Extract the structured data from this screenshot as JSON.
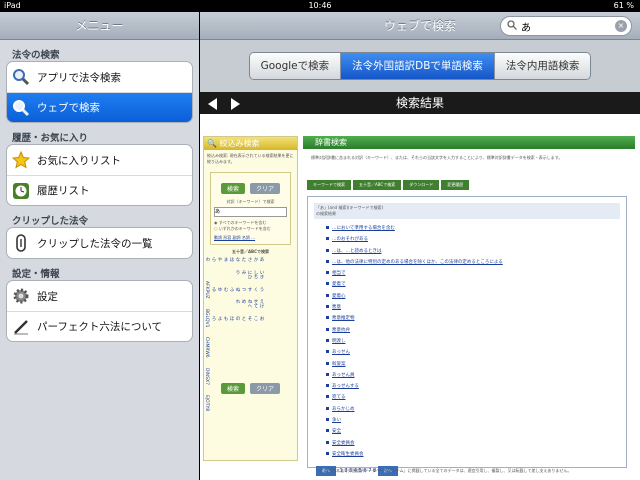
{
  "status": {
    "device": "iPad",
    "time": "10:46",
    "battery": "61 %"
  },
  "sidebar": {
    "title": "メニュー",
    "sections": [
      {
        "header": "法令の検索",
        "items": [
          {
            "label": "アプリで法令検索",
            "icon": "magnifier-icon"
          },
          {
            "label": "ウェブで検索",
            "icon": "magnifier-icon",
            "selected": true
          }
        ]
      },
      {
        "header": "履歴・お気に入り",
        "items": [
          {
            "label": "お気に入りリスト",
            "icon": "star-icon"
          },
          {
            "label": "履歴リスト",
            "icon": "clock-icon"
          }
        ]
      },
      {
        "header": "クリップした法令",
        "items": [
          {
            "label": "クリップした法令の一覧",
            "icon": "paperclip-icon"
          }
        ]
      },
      {
        "header": "設定・情報",
        "items": [
          {
            "label": "設定",
            "icon": "gear-icon"
          },
          {
            "label": "パーフェクト六法について",
            "icon": "pen-icon"
          }
        ]
      }
    ]
  },
  "main": {
    "title": "ウェブで検索",
    "search_value": "あ",
    "segments": [
      "Googleで検索",
      "法令外国語訳DBで単語検索",
      "法令内用語検索"
    ],
    "selected_segment": 1,
    "result_title": "検索結果"
  },
  "page": {
    "left_title": "絞込み検索",
    "left_desc": "絞込み検索: 現在表示されている検索結果を更に絞り込みます。",
    "search_btn": "検索",
    "clear_btn": "クリア",
    "keyword_label": "対訳（キーワード）で検索",
    "keyword_value": "あ",
    "radio_all": "すべてのキーワードを含む",
    "radio_any": "いずれかのキーワードを含む",
    "filter_links": "動詞 形容 副詞 名詞 …",
    "kana_label": "五十音／ABCで検索",
    "kana_cols": [
      "あかさたなはまやらわ",
      "いきしちにひみ　り",
      "うくすつぬふむゆる",
      "えけせてねへめ　れ",
      "おこそとのほもよろ"
    ],
    "abc_cols": [
      "AFKPUZ",
      "BGLQV1",
      "CHMRW6",
      "DINSX7",
      "EJOTY8"
    ],
    "right_title": "辞書検索",
    "right_desc": "標準対訳辞書に含まれる対訳（キーワード）、または、それらの当該文字を入力することにより、標準対訳辞書データを検索・表示します。",
    "tabs": [
      "キーワードで検索",
      "五十音／ABCで検索",
      "ダウンロード",
      "変更履歴"
    ],
    "query_note": "「あ」(and 検索)(キーワードで検索)",
    "query_note2": "の検索結果",
    "results": [
      "…において準用する場合を含む",
      "…のおそれがある",
      "…は、…と読めるときは",
      "…は、他の法律に特別の定めのある場合を除くほか、この法律の定めるところによる",
      "相当で",
      "愛着で",
      "愛着心",
      "悪意",
      "悪意推定物",
      "悪意抗弁",
      "明渡し",
      "あっせん",
      "斡旋案",
      "あっせん員",
      "あっせんする",
      "宛てる",
      "あらかじめ",
      "争い",
      "安全",
      "安全委員会",
      "安全衛生委員会"
    ],
    "pager": {
      "prev": "前へ",
      "pages": "1 2 3 4 5 6 7 8",
      "next": "次へ"
    },
    "footer": "この「日本法令外国語訳データベースシステム」に掲載している全てのデータは、適宜引用し、複製し、又は転載して差し支えありません。"
  }
}
